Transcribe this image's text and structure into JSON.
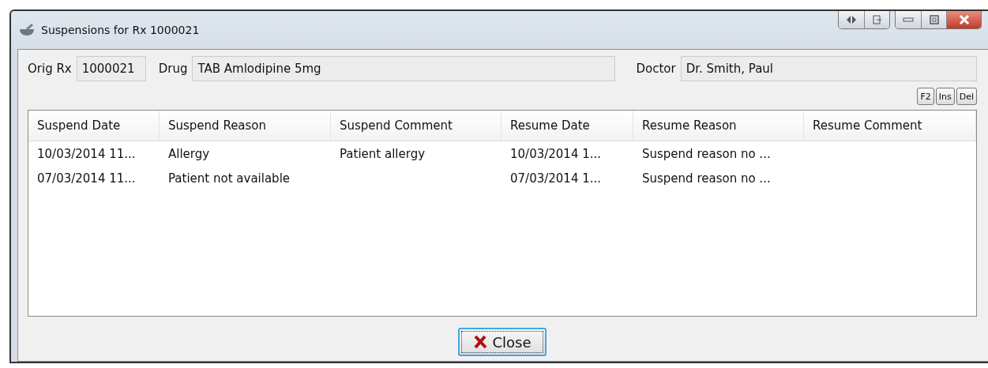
{
  "window": {
    "title": "Suspensions for Rx 1000021"
  },
  "fields": [
    {
      "label": "Orig Rx",
      "value": "1000021",
      "kind": "narrow"
    },
    {
      "label": "Drug",
      "value": "TAB Amlodipine 5mg",
      "kind": "wide"
    },
    {
      "label": "Doctor",
      "value": "Dr. Smith, Paul",
      "kind": "medium"
    }
  ],
  "small_buttons": [
    "F2",
    "Ins",
    "Del"
  ],
  "table": {
    "columns": [
      "Suspend Date",
      "Suspend Reason",
      "Suspend Comment",
      "Resume Date",
      "Resume Reason",
      "Resume Comment"
    ],
    "rows": [
      [
        "10/03/2014 11...",
        "Allergy",
        "Patient allergy",
        "10/03/2014 1...",
        "Suspend reason no ...",
        ""
      ],
      [
        "07/03/2014 11...",
        "Patient not available",
        "",
        "07/03/2014 1...",
        "Suspend reason no ...",
        ""
      ]
    ]
  },
  "close_button": {
    "label": "Close"
  }
}
